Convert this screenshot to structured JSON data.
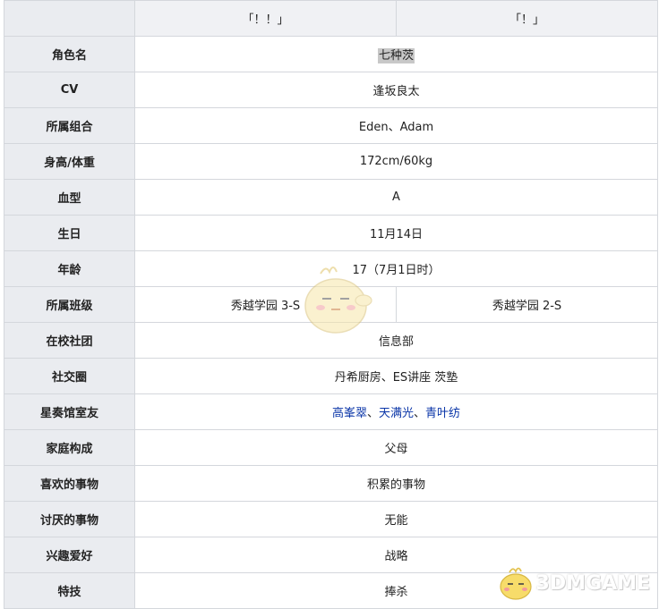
{
  "header": {
    "col1": "「！！」",
    "col2": "「！」"
  },
  "rows": {
    "name": {
      "label": "角色名",
      "value": "七种茨"
    },
    "cv": {
      "label": "CV",
      "value": "逢坂良太"
    },
    "unit": {
      "label": "所属组合",
      "value": "Eden、Adam"
    },
    "body": {
      "label": "身高/体重",
      "value": "172cm/60kg"
    },
    "blood": {
      "label": "血型",
      "value": "A"
    },
    "birthday": {
      "label": "生日",
      "value": "11月14日"
    },
    "age": {
      "label": "年龄",
      "value": "17（7月1日时）"
    },
    "class": {
      "label": "所属班级",
      "value1": "秀越学园 3-S",
      "value2": "秀越学园 2-S"
    },
    "club": {
      "label": "在校社团",
      "value": "信息部"
    },
    "circle": {
      "label": "社交圈",
      "value": "丹希厨房、ES讲座 茨塾"
    },
    "roommates": {
      "label": "星奏馆室友",
      "link1": "高峯翠",
      "sep1": "、",
      "link2": "天满光",
      "sep2": "、",
      "link3": "青叶纺"
    },
    "family": {
      "label": "家庭构成",
      "value": "父母"
    },
    "likes": {
      "label": "喜欢的事物",
      "value": "积累的事物"
    },
    "dislikes": {
      "label": "讨厌的事物",
      "value": "无能"
    },
    "hobby": {
      "label": "兴趣爱好",
      "value": "战略"
    },
    "skill": {
      "label": "特技",
      "value": "捧杀"
    }
  },
  "watermark": {
    "text": "3DMGAME",
    "icon": "chick-mascot-icon",
    "color": "#ffffff"
  },
  "colors": {
    "label_bg": "#eaecf0",
    "link": "#0b36a8",
    "highlight": "#c8c8c8"
  }
}
